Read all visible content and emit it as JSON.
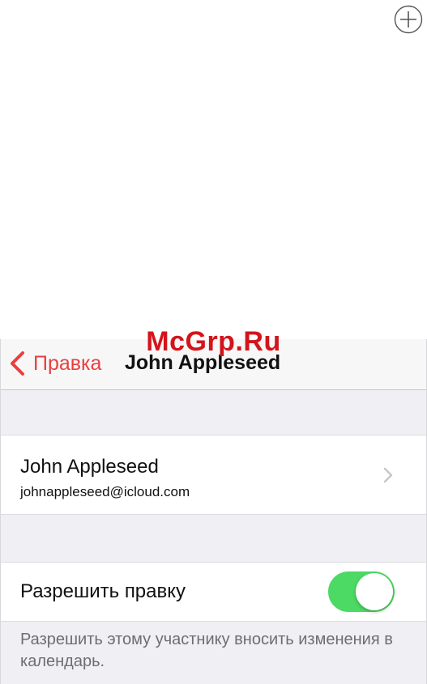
{
  "top_toolbar": {
    "add_icon": "plus-circle-icon"
  },
  "watermark": {
    "text": "McGrp.Ru"
  },
  "navbar": {
    "back_label": "Правка",
    "back_icon": "chevron-left-icon",
    "title": "John Appleseed",
    "accent_color": "#ea3f3e"
  },
  "contact": {
    "name": "John Appleseed",
    "email": "johnappleseed@icloud.com",
    "disclosure_icon": "chevron-right-icon"
  },
  "permission": {
    "label": "Разрешить правку",
    "enabled": true,
    "switch_color": "#4cd964"
  },
  "footer": {
    "text": "Разрешить этому участнику вносить изменения в календарь."
  }
}
